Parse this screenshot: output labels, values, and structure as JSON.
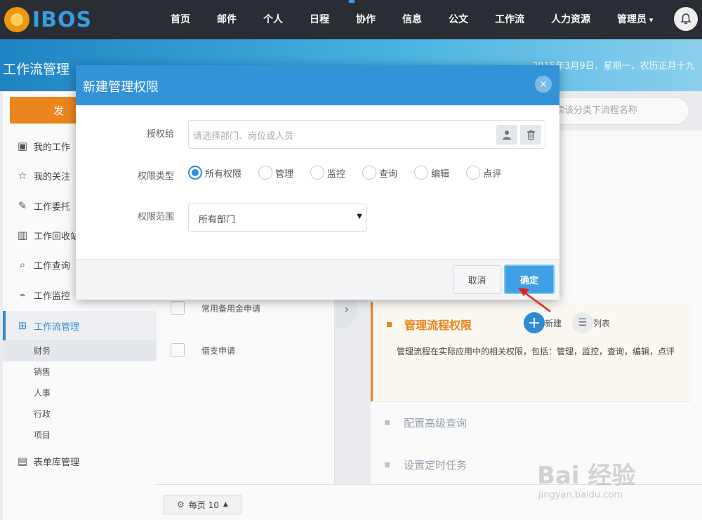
{
  "brand": {
    "logo_text": "IBOS"
  },
  "nav": {
    "items": [
      "首页",
      "邮件",
      "个人",
      "日程",
      "协作",
      "信息",
      "公文",
      "工作流",
      "人力资源"
    ],
    "admin_label": "管理员"
  },
  "header": {
    "title": "工作流管理",
    "date": "2015年3月9日，星期一，农历正月十九"
  },
  "sidebar": {
    "launch_label": "发",
    "items": [
      {
        "label": "我的工作",
        "icon": "briefcase-icon"
      },
      {
        "label": "我的关注",
        "icon": "star-icon"
      },
      {
        "label": "工作委托",
        "icon": "document-edit-icon"
      },
      {
        "label": "工作回收站",
        "icon": "trash-icon"
      },
      {
        "label": "工作查询",
        "icon": "search-doc-icon"
      },
      {
        "label": "工作监控",
        "icon": "monitor-icon"
      },
      {
        "label": "工作流管理",
        "icon": "workflow-icon"
      },
      {
        "label": "表单库管理",
        "icon": "form-icon"
      }
    ],
    "sub_items": [
      "财务",
      "销售",
      "人事",
      "行政",
      "项目"
    ]
  },
  "midlist": {
    "rows": [
      "常用备用金申请",
      "借支申请"
    ]
  },
  "search": {
    "placeholder": "索该分类下流程名称"
  },
  "panel": {
    "card_title": "管理流程权限",
    "new_label": "新建",
    "list_label": "列表",
    "card_desc": "管理流程在实际应用中的相关权限，包括：管理，监控，查询，编辑，点评",
    "items": [
      "配置高级查询",
      "设置定时任务"
    ]
  },
  "footer": {
    "per_page": "每页 10"
  },
  "watermark": {
    "brand": "Bai 经验",
    "url": "jingyan.baidu.com"
  },
  "modal": {
    "title": "新建管理权限",
    "close_label": "×",
    "auth_label": "授权给",
    "auth_placeholder": "请选择部门、岗位或人员",
    "type_label": "权限类型",
    "type_options": [
      "所有权限",
      "管理",
      "监控",
      "查询",
      "编辑",
      "点评"
    ],
    "type_selected": "所有权限",
    "scope_label": "权限范围",
    "scope_value": "所有部门",
    "cancel_label": "取消",
    "ok_label": "确定"
  },
  "colors": {
    "nav_bg": "#2b2e36",
    "brand_blue": "#3393d9",
    "accent_orange": "#f0871c",
    "annotation_red": "#e2231a"
  }
}
